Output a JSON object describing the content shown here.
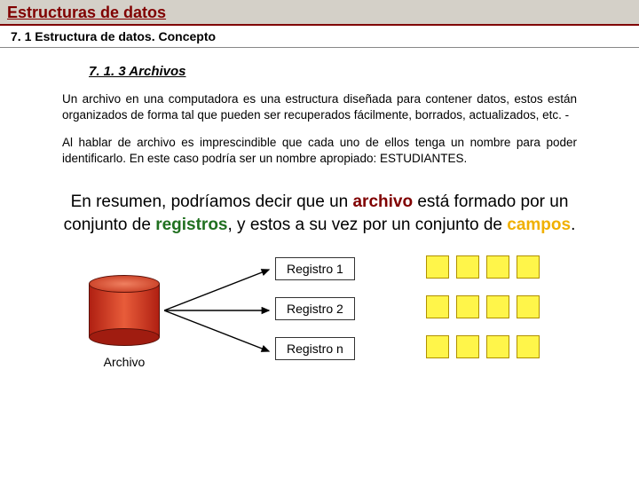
{
  "title": "Estructuras de datos",
  "subtitle": "7. 1 Estructura de datos. Concepto",
  "section_heading": "7. 1. 3 Archivos",
  "para1": "Un archivo en una computadora es una estructura diseñada para contener datos, estos están organizados de forma tal que pueden ser recuperados fácilmente, borrados, actualizados, etc. -",
  "para2": "Al hablar de archivo es imprescindible que cada uno de ellos tenga un nombre para poder identificarlo. En este caso podría ser un nombre apropiado: ESTUDIANTES.",
  "summary_pre": "En resumen, podríamos decir que un ",
  "summary_kw1": "archivo",
  "summary_mid1": " está formado por un conjunto de ",
  "summary_kw2": "registros",
  "summary_mid2": ", y estos a su vez por un conjunto de ",
  "summary_kw3": "campos",
  "summary_end": ".",
  "diagram": {
    "archivo_label": "Archivo",
    "reg1": "Registro 1",
    "reg2": "Registro 2",
    "regn": "Registro n"
  }
}
